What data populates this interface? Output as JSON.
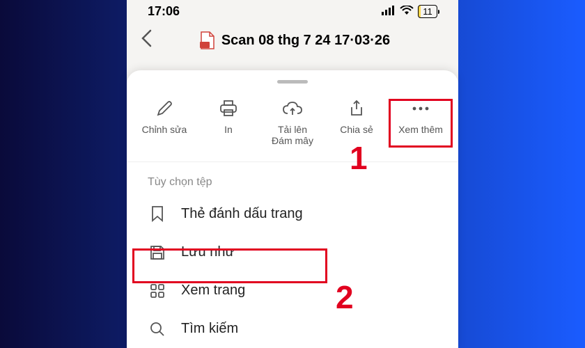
{
  "status": {
    "time": "17:06",
    "battery": "11"
  },
  "nav": {
    "title": "Scan 08 thg 7 24 17·03·26"
  },
  "actions": {
    "edit": "Chỉnh sửa",
    "print": "In",
    "upload": "Tải lên\nĐám mây",
    "share": "Chia sẻ",
    "more": "Xem thêm"
  },
  "section": {
    "file_options": "Tùy chọn tệp"
  },
  "menu": {
    "bookmark": "Thẻ đánh dấu trang",
    "save_as": "Lưu như",
    "view_page": "Xem trang",
    "search": "Tìm kiếm"
  },
  "callouts": {
    "one": "1",
    "two": "2"
  }
}
